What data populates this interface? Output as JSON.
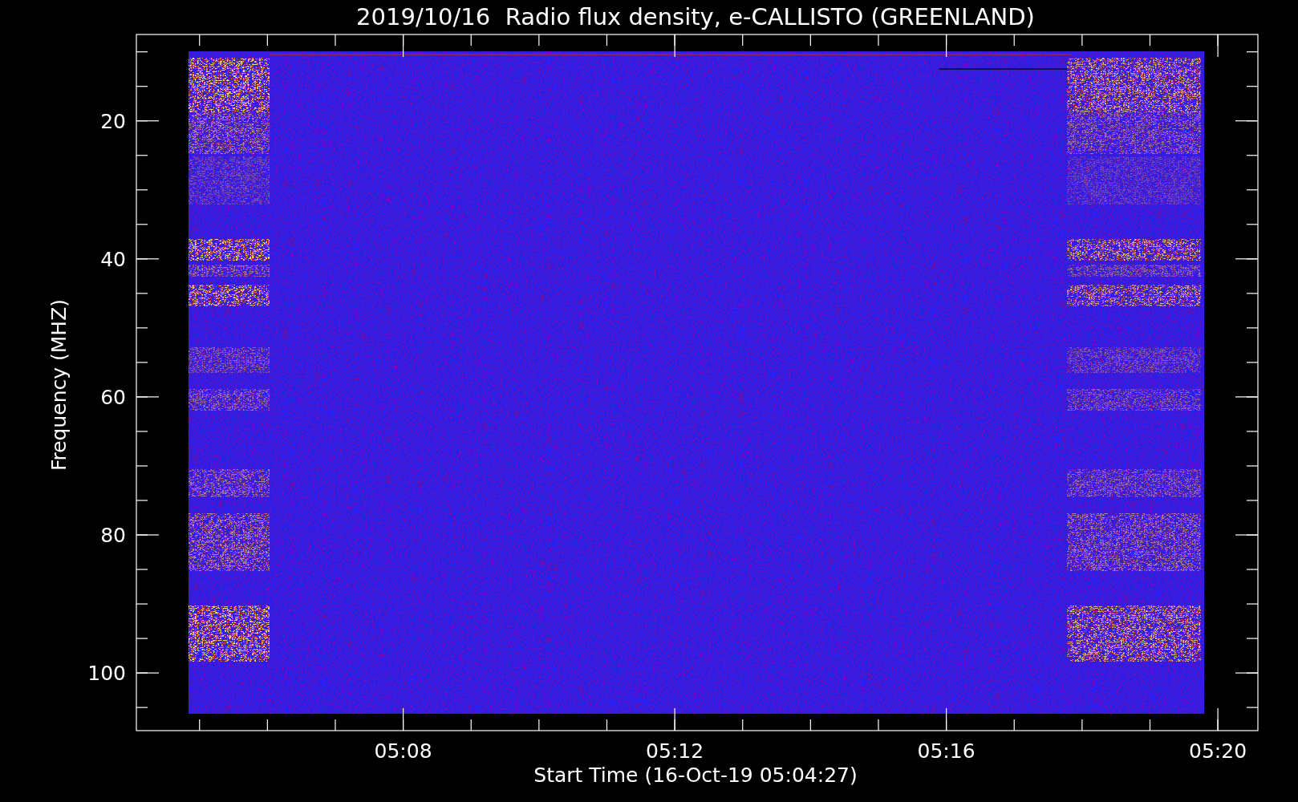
{
  "title": "2019/10/16  Radio flux density, e-CALLISTO (GREENLAND)",
  "y_axis": {
    "label": "Frequency (MHZ)",
    "ticks": [
      "20",
      "40",
      "60",
      "80",
      "100"
    ]
  },
  "x_axis": {
    "label": "Start Time (16-Oct-19 05:04:27)",
    "ticks": [
      "05:08",
      "05:12",
      "05:16",
      "05:20"
    ]
  }
}
